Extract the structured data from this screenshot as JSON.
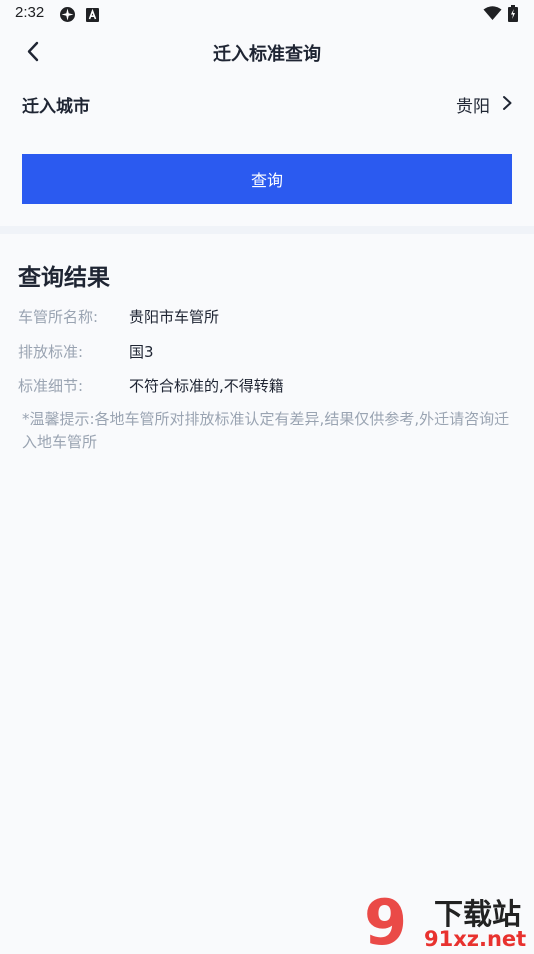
{
  "status_bar": {
    "time": "2:32"
  },
  "header": {
    "title": "迁入标准查询"
  },
  "city": {
    "label": "迁入城市",
    "value": "贵阳"
  },
  "query_button": {
    "label": "查询"
  },
  "results": {
    "title": "查询结果",
    "rows": [
      {
        "key": "车管所名称:",
        "value": "贵阳市车管所"
      },
      {
        "key": "排放标准:",
        "value": "国3"
      },
      {
        "key": "标准细节:",
        "value": "不符合标准的,不得转籍"
      }
    ],
    "tip": "*温馨提示:各地车管所对排放标准认定有差异,结果仅供参考,外迁请咨询迁入地车管所"
  },
  "watermark": {
    "text_cn": "下载站",
    "text_en": "91xz.net",
    "logo_text": "9"
  },
  "colors": {
    "accent": "#2b5af0",
    "muted": "#9aa4b2",
    "watermark_red": "#e8322f"
  }
}
